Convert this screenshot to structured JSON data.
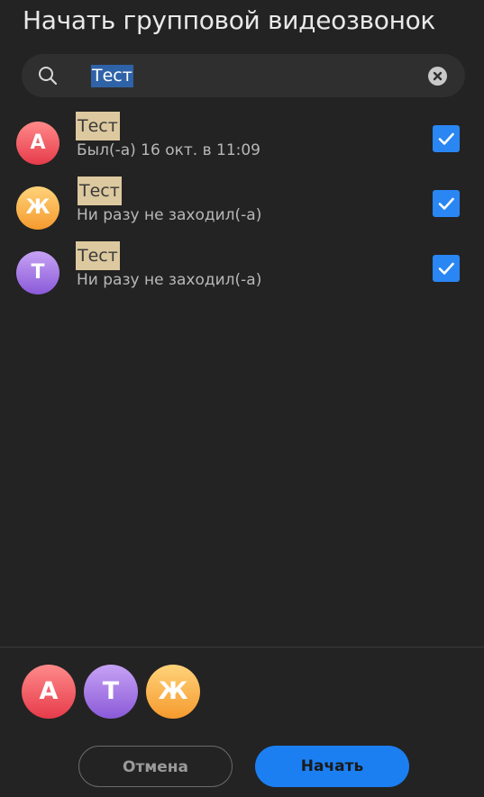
{
  "dialog": {
    "title": "Начать групповой видеозвонок"
  },
  "search": {
    "value": "Тест",
    "icon": "search-icon",
    "clear_icon": "clear-icon"
  },
  "contacts": [
    {
      "initial": "А",
      "name": "Тест",
      "status": "Был(-а) 16 окт. в 11:09",
      "checked": true,
      "gradient": [
        "#ff8a8a",
        "#e63b4a"
      ]
    },
    {
      "initial": "Ж",
      "name": "Тест",
      "status": "Ни разу не заходил(-а)",
      "checked": true,
      "gradient": [
        "#ffd37a",
        "#f59a2e"
      ]
    },
    {
      "initial": "Т",
      "name": "Тест",
      "status": "Ни разу не заходил(-а)",
      "checked": true,
      "gradient": [
        "#c7a2f5",
        "#8a5ad8"
      ]
    }
  ],
  "selected": [
    {
      "initial": "А",
      "gradient": [
        "#ff8a8a",
        "#e63b4a"
      ]
    },
    {
      "initial": "Т",
      "gradient": [
        "#c7a2f5",
        "#8a5ad8"
      ]
    },
    {
      "initial": "Ж",
      "gradient": [
        "#ffd37a",
        "#f59a2e"
      ]
    }
  ],
  "actions": {
    "cancel_label": "Отмена",
    "start_label": "Начать"
  },
  "colors": {
    "background": "#232323",
    "accent": "#1b7ff2",
    "highlight": "#ddc99f"
  }
}
